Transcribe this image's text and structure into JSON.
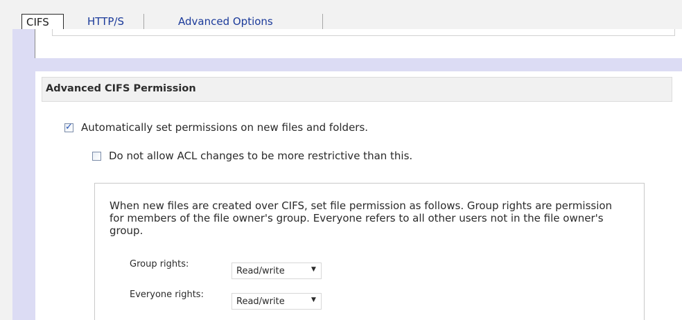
{
  "tabs": [
    {
      "label": "CIFS"
    },
    {
      "label": "HTTP/S"
    },
    {
      "label": "Advanced Options"
    }
  ],
  "section": {
    "title": "Advanced CIFS Permission"
  },
  "options": {
    "auto_permissions": {
      "label": "Automatically set permissions on new files and folders.",
      "checked": true
    },
    "no_acl_restrict": {
      "label": "Do not allow ACL changes to be more restrictive than this.",
      "checked": false
    }
  },
  "description": "When new files are created over CIFS, set file permission as follows. Group rights are permission for members of the file owner's group. Everyone refers to all other users not in the file owner's group.",
  "fields": {
    "group_rights": {
      "label": "Group rights:",
      "value": "Read/write"
    },
    "everyone_rights": {
      "label": "Everyone rights:",
      "value": "Read/write"
    }
  },
  "colors": {
    "tab_link": "#1b3a9a",
    "panel_bg": "#dcdcf4",
    "checkmark": "#2452b5"
  },
  "icons": {
    "dropdown": "chevron-down-icon",
    "checkbox_checked": "check-icon"
  }
}
